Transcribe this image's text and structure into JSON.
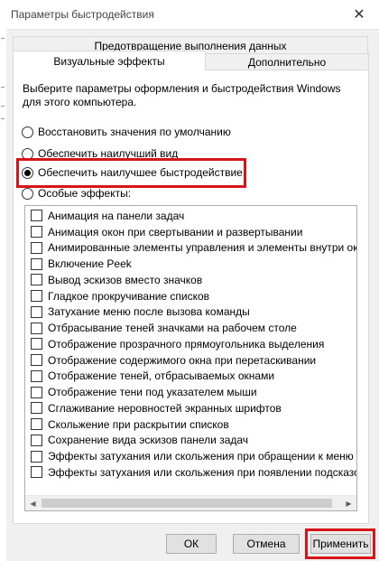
{
  "window": {
    "title": "Параметры быстродействия",
    "close_symbol": "✕"
  },
  "tabs": {
    "top_row": "Предотвращение выполнения данных",
    "visual_effects": "Визуальные эффекты",
    "advanced": "Дополнительно"
  },
  "panel": {
    "description": "Выберите параметры оформления и быстродействия Windows для этого компьютера.",
    "radios": [
      {
        "label": "Восстановить значения по умолчанию",
        "selected": false
      },
      {
        "label": "Обеспечить наилучший вид",
        "selected": false
      },
      {
        "label": "Обеспечить наилучшее быстродействие",
        "selected": true
      },
      {
        "label": "Особые эффекты:",
        "selected": false
      }
    ],
    "effects": [
      "Анимация на панели задач",
      "Анимация окон при свертывании и развертывании",
      "Анимированные элементы управления и элементы внутри окн",
      "Включение Peek",
      "Вывод эскизов вместо значков",
      "Гладкое прокручивание списков",
      "Затухание меню после вызова команды",
      "Отбрасывание теней значками на рабочем столе",
      "Отображение прозрачного прямоугольника выделения",
      "Отображение содержимого окна при перетаскивании",
      "Отображение теней, отбрасываемых окнами",
      "Отображение тени под указателем мыши",
      "Сглаживание неровностей экранных шрифтов",
      "Скольжение при раскрытии списков",
      "Сохранение вида эскизов панели задач",
      "Эффекты затухания или скольжения при обращении к меню",
      "Эффекты затухания или скольжения при появлении подсказок"
    ]
  },
  "buttons": {
    "ok": "ОК",
    "cancel": "Отмена",
    "apply": "Применить"
  },
  "colors": {
    "highlight": "#d7141a"
  }
}
